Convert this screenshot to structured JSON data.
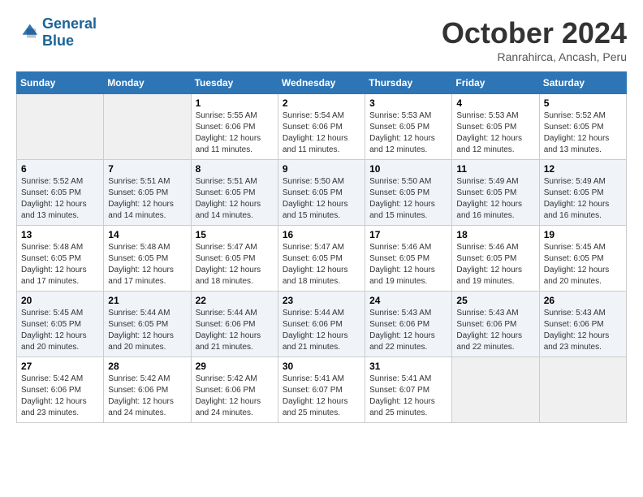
{
  "logo": {
    "line1": "General",
    "line2": "Blue"
  },
  "header": {
    "month": "October 2024",
    "location": "Ranrahirca, Ancash, Peru"
  },
  "weekdays": [
    "Sunday",
    "Monday",
    "Tuesday",
    "Wednesday",
    "Thursday",
    "Friday",
    "Saturday"
  ],
  "weeks": [
    [
      {
        "day": "",
        "info": ""
      },
      {
        "day": "",
        "info": ""
      },
      {
        "day": "1",
        "info": "Sunrise: 5:55 AM\nSunset: 6:06 PM\nDaylight: 12 hours and 11 minutes."
      },
      {
        "day": "2",
        "info": "Sunrise: 5:54 AM\nSunset: 6:06 PM\nDaylight: 12 hours and 11 minutes."
      },
      {
        "day": "3",
        "info": "Sunrise: 5:53 AM\nSunset: 6:05 PM\nDaylight: 12 hours and 12 minutes."
      },
      {
        "day": "4",
        "info": "Sunrise: 5:53 AM\nSunset: 6:05 PM\nDaylight: 12 hours and 12 minutes."
      },
      {
        "day": "5",
        "info": "Sunrise: 5:52 AM\nSunset: 6:05 PM\nDaylight: 12 hours and 13 minutes."
      }
    ],
    [
      {
        "day": "6",
        "info": "Sunrise: 5:52 AM\nSunset: 6:05 PM\nDaylight: 12 hours and 13 minutes."
      },
      {
        "day": "7",
        "info": "Sunrise: 5:51 AM\nSunset: 6:05 PM\nDaylight: 12 hours and 14 minutes."
      },
      {
        "day": "8",
        "info": "Sunrise: 5:51 AM\nSunset: 6:05 PM\nDaylight: 12 hours and 14 minutes."
      },
      {
        "day": "9",
        "info": "Sunrise: 5:50 AM\nSunset: 6:05 PM\nDaylight: 12 hours and 15 minutes."
      },
      {
        "day": "10",
        "info": "Sunrise: 5:50 AM\nSunset: 6:05 PM\nDaylight: 12 hours and 15 minutes."
      },
      {
        "day": "11",
        "info": "Sunrise: 5:49 AM\nSunset: 6:05 PM\nDaylight: 12 hours and 16 minutes."
      },
      {
        "day": "12",
        "info": "Sunrise: 5:49 AM\nSunset: 6:05 PM\nDaylight: 12 hours and 16 minutes."
      }
    ],
    [
      {
        "day": "13",
        "info": "Sunrise: 5:48 AM\nSunset: 6:05 PM\nDaylight: 12 hours and 17 minutes."
      },
      {
        "day": "14",
        "info": "Sunrise: 5:48 AM\nSunset: 6:05 PM\nDaylight: 12 hours and 17 minutes."
      },
      {
        "day": "15",
        "info": "Sunrise: 5:47 AM\nSunset: 6:05 PM\nDaylight: 12 hours and 18 minutes."
      },
      {
        "day": "16",
        "info": "Sunrise: 5:47 AM\nSunset: 6:05 PM\nDaylight: 12 hours and 18 minutes."
      },
      {
        "day": "17",
        "info": "Sunrise: 5:46 AM\nSunset: 6:05 PM\nDaylight: 12 hours and 19 minutes."
      },
      {
        "day": "18",
        "info": "Sunrise: 5:46 AM\nSunset: 6:05 PM\nDaylight: 12 hours and 19 minutes."
      },
      {
        "day": "19",
        "info": "Sunrise: 5:45 AM\nSunset: 6:05 PM\nDaylight: 12 hours and 20 minutes."
      }
    ],
    [
      {
        "day": "20",
        "info": "Sunrise: 5:45 AM\nSunset: 6:05 PM\nDaylight: 12 hours and 20 minutes."
      },
      {
        "day": "21",
        "info": "Sunrise: 5:44 AM\nSunset: 6:05 PM\nDaylight: 12 hours and 20 minutes."
      },
      {
        "day": "22",
        "info": "Sunrise: 5:44 AM\nSunset: 6:06 PM\nDaylight: 12 hours and 21 minutes."
      },
      {
        "day": "23",
        "info": "Sunrise: 5:44 AM\nSunset: 6:06 PM\nDaylight: 12 hours and 21 minutes."
      },
      {
        "day": "24",
        "info": "Sunrise: 5:43 AM\nSunset: 6:06 PM\nDaylight: 12 hours and 22 minutes."
      },
      {
        "day": "25",
        "info": "Sunrise: 5:43 AM\nSunset: 6:06 PM\nDaylight: 12 hours and 22 minutes."
      },
      {
        "day": "26",
        "info": "Sunrise: 5:43 AM\nSunset: 6:06 PM\nDaylight: 12 hours and 23 minutes."
      }
    ],
    [
      {
        "day": "27",
        "info": "Sunrise: 5:42 AM\nSunset: 6:06 PM\nDaylight: 12 hours and 23 minutes."
      },
      {
        "day": "28",
        "info": "Sunrise: 5:42 AM\nSunset: 6:06 PM\nDaylight: 12 hours and 24 minutes."
      },
      {
        "day": "29",
        "info": "Sunrise: 5:42 AM\nSunset: 6:06 PM\nDaylight: 12 hours and 24 minutes."
      },
      {
        "day": "30",
        "info": "Sunrise: 5:41 AM\nSunset: 6:07 PM\nDaylight: 12 hours and 25 minutes."
      },
      {
        "day": "31",
        "info": "Sunrise: 5:41 AM\nSunset: 6:07 PM\nDaylight: 12 hours and 25 minutes."
      },
      {
        "day": "",
        "info": ""
      },
      {
        "day": "",
        "info": ""
      }
    ]
  ]
}
